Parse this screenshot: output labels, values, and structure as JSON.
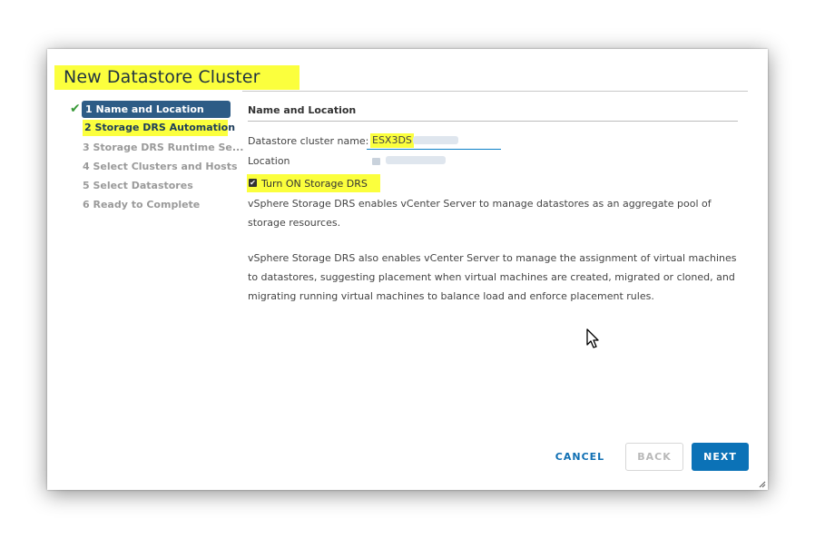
{
  "dialog": {
    "title": "New Datastore Cluster"
  },
  "steps": [
    {
      "label": "1 Name and Location",
      "state": "active-completed"
    },
    {
      "label": "2 Storage DRS Automation",
      "state": "highlighted"
    },
    {
      "label": "3 Storage DRS Runtime Se...",
      "state": "disabled"
    },
    {
      "label": "4 Select Clusters and Hosts",
      "state": "disabled"
    },
    {
      "label": "5 Select Datastores",
      "state": "disabled"
    },
    {
      "label": "6 Ready to Complete",
      "state": "disabled"
    }
  ],
  "content": {
    "section_title": "Name and Location",
    "name_label": "Datastore cluster name:",
    "name_value": "ESX3DS",
    "location_label": "Location",
    "drs_checkbox_label": "Turn ON Storage DRS",
    "drs_checked": true,
    "paragraph1": "vSphere Storage DRS enables vCenter Server to manage datastores as an aggregate pool of storage resources.",
    "paragraph2": "vSphere Storage DRS also enables vCenter Server to manage the assignment of virtual machines to datastores, suggesting placement when virtual machines are created, migrated or cloned, and migrating running virtual machines to balance load and enforce placement rules."
  },
  "footer": {
    "cancel_label": "CANCEL",
    "back_label": "BACK",
    "next_label": "NEXT"
  },
  "colors": {
    "highlight": "#fbff3d",
    "active_step_bg": "#2d5c86",
    "primary_button": "#0b72b7",
    "check_green": "#3a9a39"
  }
}
